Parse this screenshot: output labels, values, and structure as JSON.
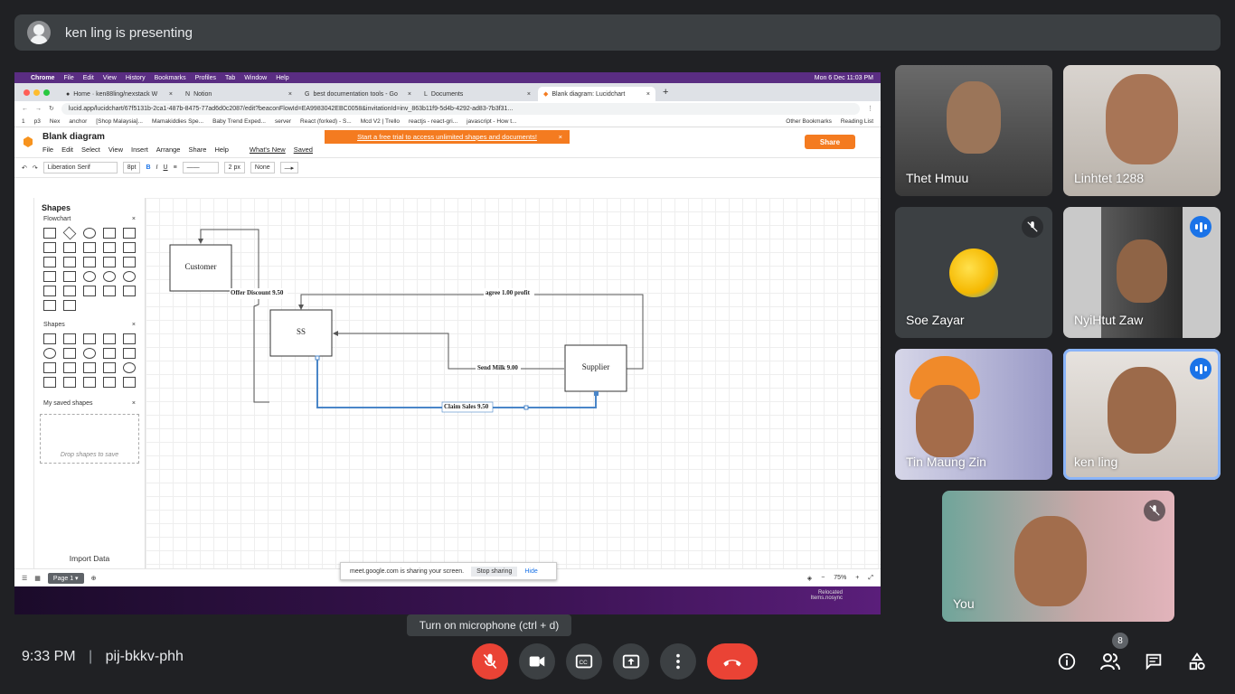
{
  "meet": {
    "presenter_text": "ken ling is presenting",
    "time": "9:33 PM",
    "meeting_code": "pij-bkkv-phh",
    "tooltip": "Turn on microphone (ctrl + d)",
    "people_count": "8"
  },
  "participants": [
    {
      "name": "Thet Hmuu",
      "state": "video"
    },
    {
      "name": "Linhtet 1288",
      "state": "video"
    },
    {
      "name": "Soe Zayar",
      "state": "avatar-muted"
    },
    {
      "name": "NyiHtut Zaw",
      "state": "speaking"
    },
    {
      "name": "Tin Maung Zin",
      "state": "video"
    },
    {
      "name": "ken ling",
      "state": "speaking-selected"
    },
    {
      "name": "You",
      "state": "muted"
    }
  ],
  "mac": {
    "app": "Chrome",
    "menus": [
      "File",
      "Edit",
      "View",
      "History",
      "Bookmarks",
      "Profiles",
      "Tab",
      "Window",
      "Help"
    ],
    "clock": "Mon 6 Dec  11:03 PM"
  },
  "browser": {
    "tabs": [
      {
        "label": "Home · ken88ling/nexstack W"
      },
      {
        "label": "Notion"
      },
      {
        "label": "best documentation tools - Go"
      },
      {
        "label": "Documents"
      },
      {
        "label": "Blank diagram: Lucidchart"
      }
    ],
    "url": "lucid.app/lucidchart/67f5131b-2ca1-487b-8475-77ad6d0c2087/edit?beaconFlowId=EA9983042EBC0058&invitationId=inv_863b11f9-5d4b-4292-ad83-7b3f31...",
    "bookmarks": [
      "1",
      "p3",
      "Nex",
      "anchor",
      "[Shop Malaysia]...",
      "Mamakiddies Spe...",
      "Baby Trend Exped...",
      "server",
      "React (forked) - S...",
      "Mcd V2 | Trello",
      "reactjs - react-gri...",
      "javascript - How t...",
      "Other Bookmarks",
      "Reading List"
    ]
  },
  "lucid": {
    "doc_title": "Blank diagram",
    "menus": [
      "File",
      "Edit",
      "Select",
      "View",
      "Insert",
      "Arrange",
      "Share",
      "Help"
    ],
    "whats_new": "What's New",
    "saved": "Saved",
    "trial_banner": "Start a free trial to access unlimited shapes and documents!",
    "share": "Share",
    "font": "Liberation Serif",
    "font_size": "8pt",
    "line_width": "2 px",
    "arrow_start": "None",
    "panel_title": "Shapes",
    "section_flowchart": "Flowchart",
    "section_shapes": "Shapes",
    "section_saved": "My saved shapes",
    "saved_hint": "Drop shapes to save",
    "import_data": "Import Data",
    "page_tab": "Page 1",
    "zoom": "75%"
  },
  "diagram": {
    "nodes": {
      "customer": "Customer",
      "ss": "SS",
      "supplier": "Supplier"
    },
    "edges": {
      "offer": "Offer Discount 9.50",
      "agree": "agree 1.00 profit",
      "send": "Send Milk 9.00",
      "claim": "Claim Sales 9.50"
    }
  },
  "screen_share_bar": {
    "text": "meet.google.com is sharing your screen.",
    "stop": "Stop sharing",
    "hide": "Hide"
  },
  "desktop": {
    "line1": "Relocated",
    "line2": "Items.nosync"
  }
}
